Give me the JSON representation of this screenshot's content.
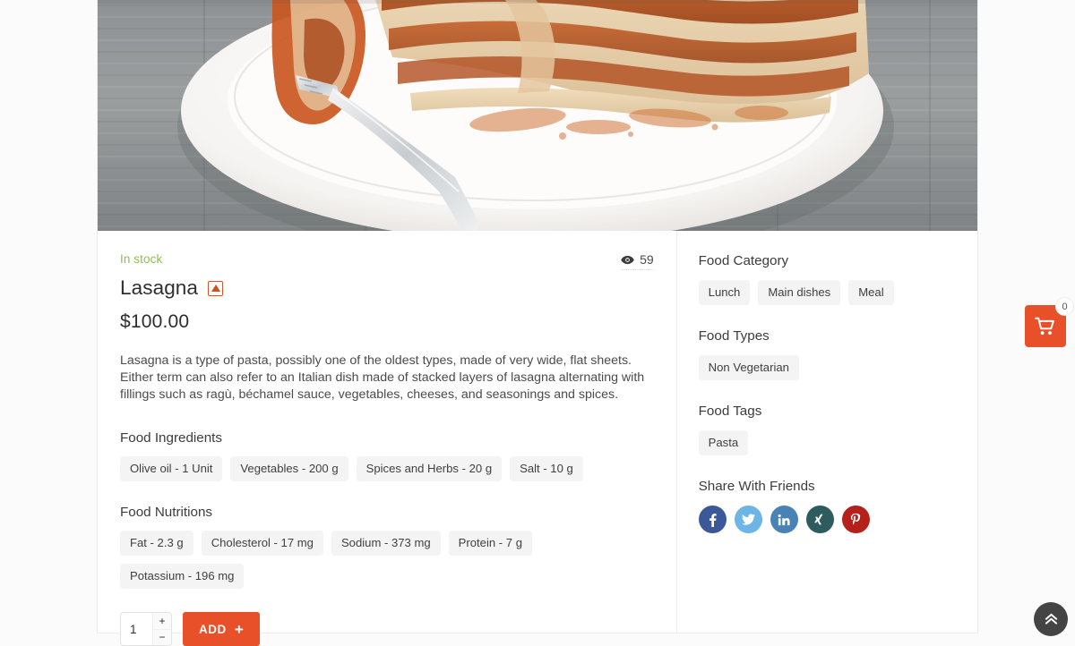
{
  "product": {
    "stock_status": "In stock",
    "views_count": "59",
    "views_icon": "eye-icon",
    "title": "Lasagna",
    "diet_badge": "non-vegetarian-icon",
    "price": "$100.00",
    "description": "Lasagna is a type of pasta, possibly one of the oldest types, made of very wide, flat sheets. Either term can also refer to an Italian dish made of stacked layers of lasagna alternating with fillings such as ragù, béchamel sauce, vegetables, cheeses, and seasonings and spices.",
    "image_alt": "lasagna-in-white-bowl-with-fork"
  },
  "ingredients": {
    "heading": "Food Ingredients",
    "items": [
      "Olive oil - 1 Unit",
      "Vegetables - 200 g",
      "Spices and Herbs - 20 g",
      "Salt - 10 g"
    ]
  },
  "nutritions": {
    "heading": "Food Nutritions",
    "items": [
      "Fat - 2.3 g",
      "Cholesterol - 17 mg",
      "Sodium - 373 mg",
      "Protein - 7 g",
      "Potassium - 196 mg"
    ]
  },
  "purchase": {
    "quantity": "1",
    "increment_label": "+",
    "decrement_label": "−",
    "add_label": "ADD",
    "add_icon": "plus-icon"
  },
  "sidebar": {
    "category": {
      "heading": "Food Category",
      "items": [
        "Lunch",
        "Main dishes",
        "Meal"
      ]
    },
    "types": {
      "heading": "Food Types",
      "items": [
        "Non Vegetarian"
      ]
    },
    "tags": {
      "heading": "Food Tags",
      "items": [
        "Pasta"
      ]
    },
    "share": {
      "heading": "Share With Friends",
      "networks": [
        {
          "name": "facebook",
          "glyph": "f",
          "color": "#3b5998"
        },
        {
          "name": "twitter",
          "glyph": "t",
          "color": "#6cb5e4"
        },
        {
          "name": "linkedin",
          "glyph": "in",
          "color": "#4a82b5"
        },
        {
          "name": "xing",
          "glyph": "X",
          "color": "#2e5b5e"
        },
        {
          "name": "pinterest",
          "glyph": "p",
          "color": "#b5201b"
        }
      ]
    }
  },
  "floating": {
    "cart_icon": "shopping-cart-icon",
    "cart_count": "0",
    "scroll_top_icon": "double-chevron-up-icon"
  },
  "colors": {
    "accent": "#e8502a",
    "in_stock": "#8cc152",
    "chip_bg": "#f4f4f4",
    "nonveg": "#c9521f"
  }
}
